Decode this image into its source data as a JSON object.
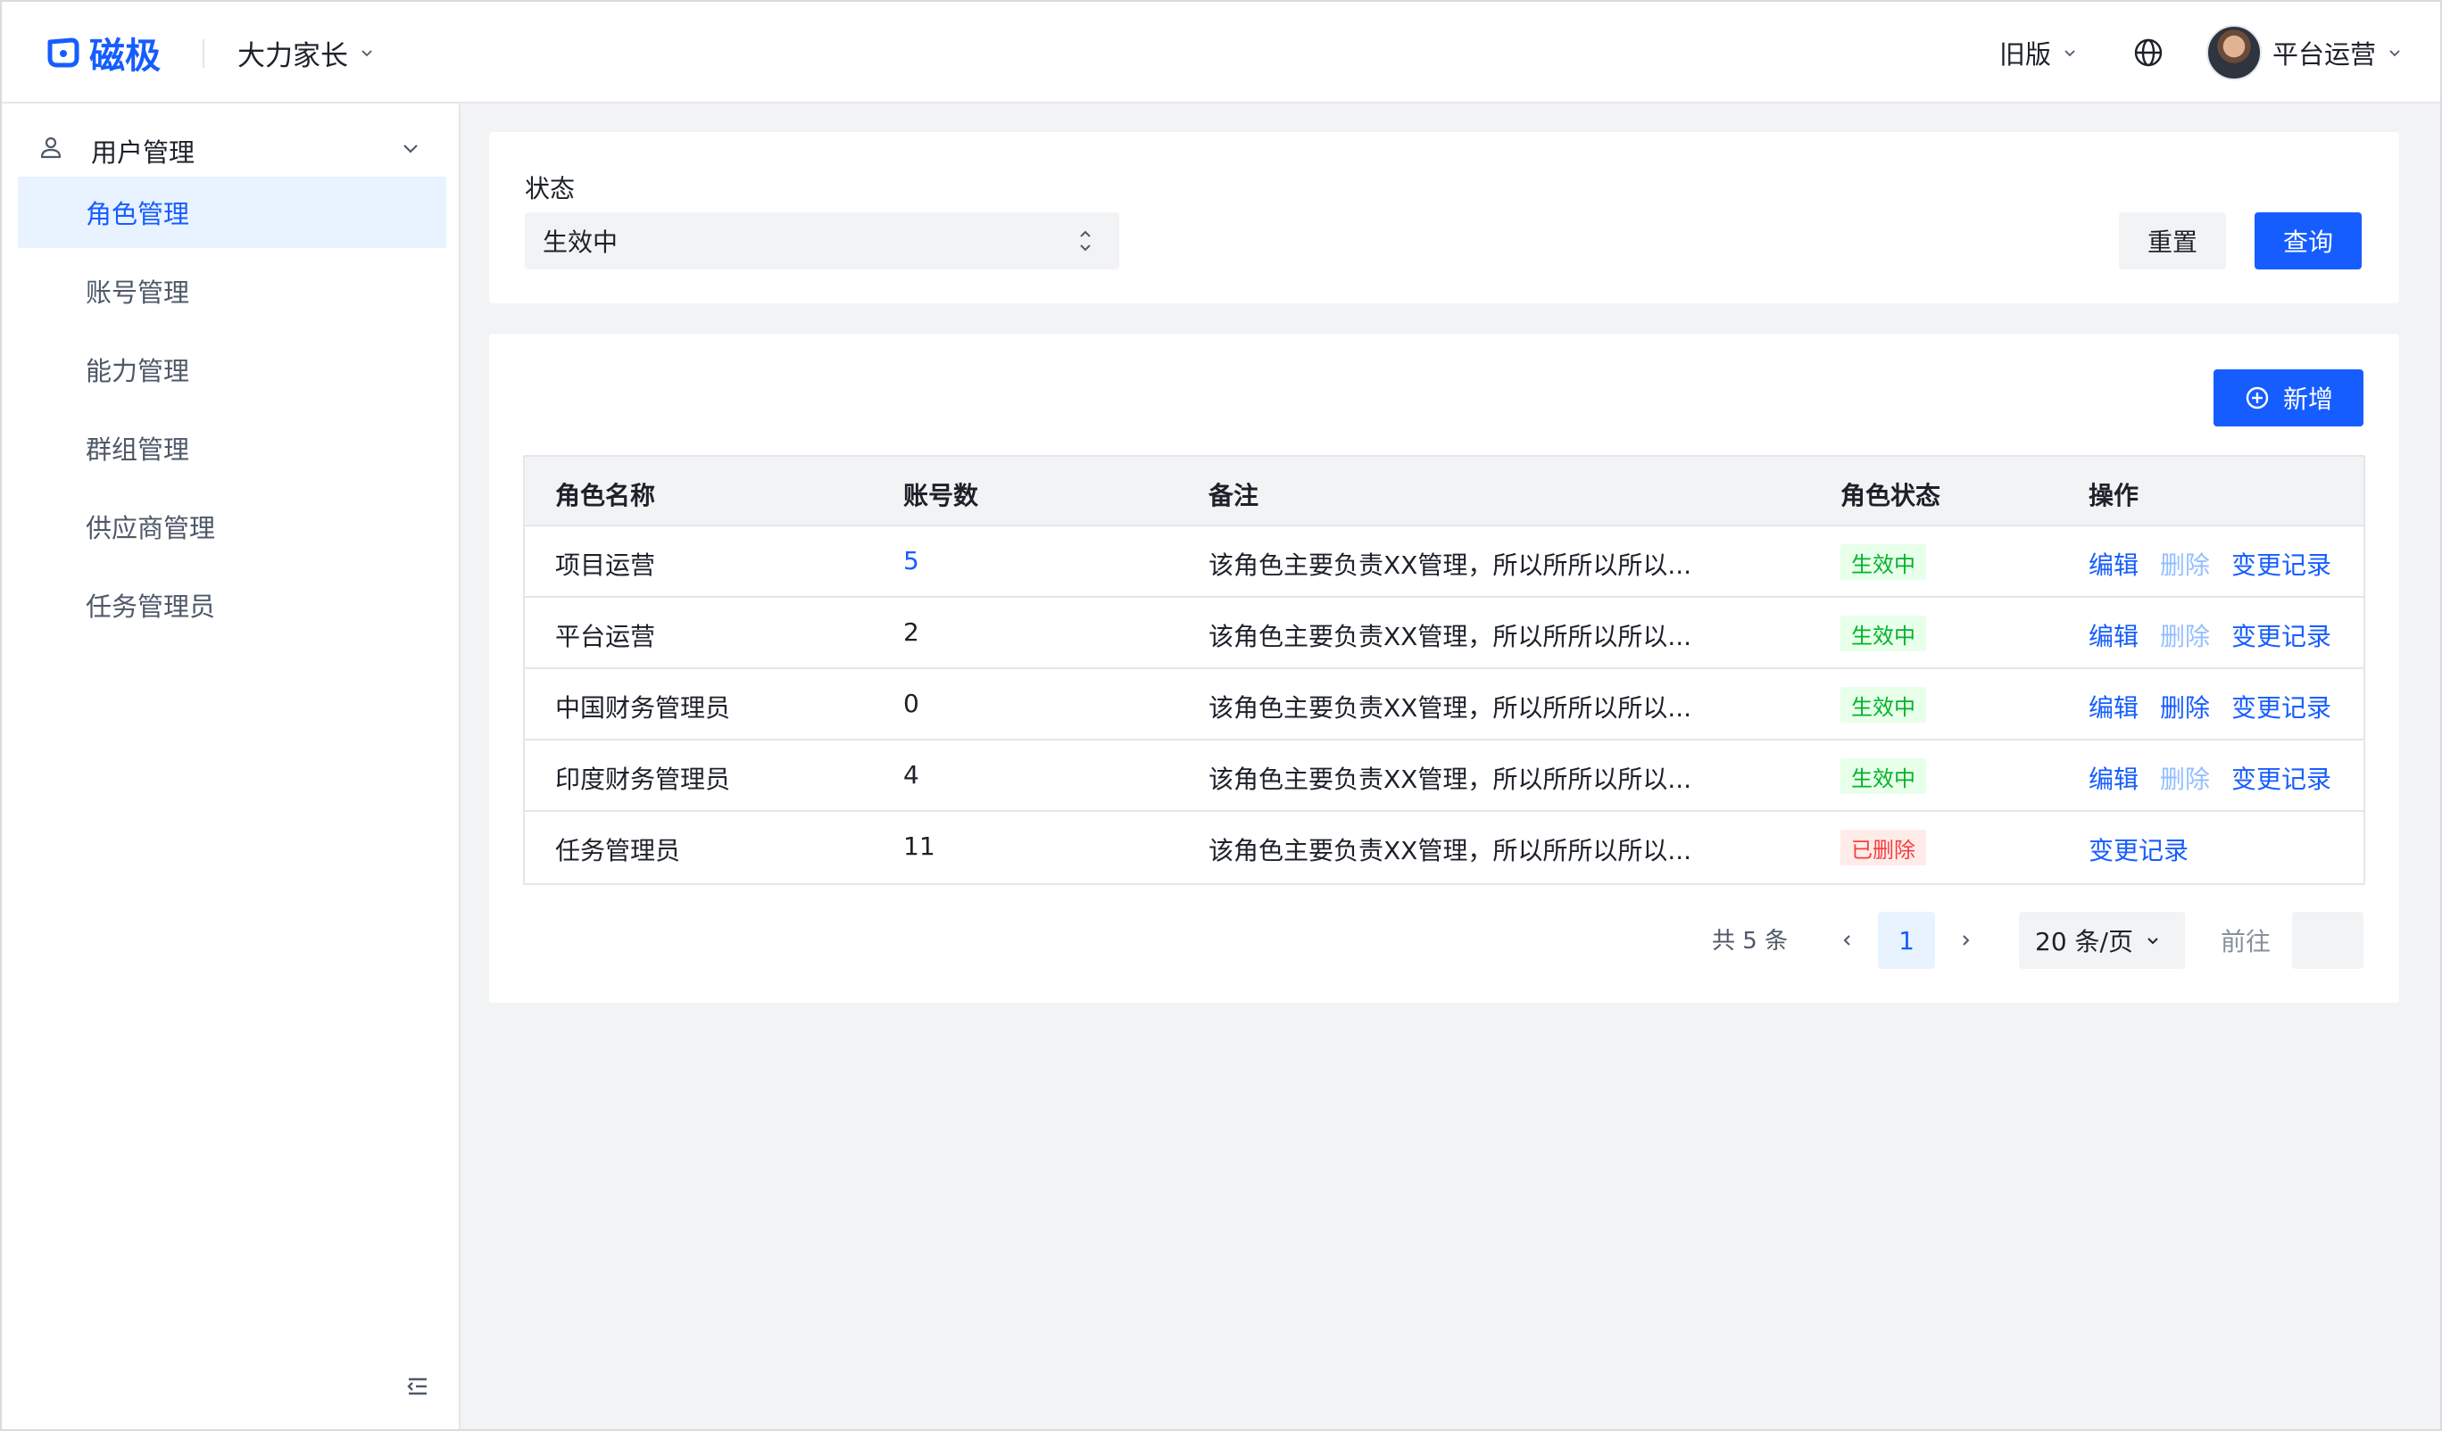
{
  "header": {
    "logo_text": "磁极",
    "tenant": "大力家长",
    "old_version": "旧版",
    "user_name": "平台运营"
  },
  "sidebar": {
    "group_label": "用户管理",
    "items": [
      {
        "label": "角色管理",
        "active": true
      },
      {
        "label": "账号管理",
        "active": false
      },
      {
        "label": "能力管理",
        "active": false
      },
      {
        "label": "群组管理",
        "active": false
      },
      {
        "label": "供应商管理",
        "active": false
      },
      {
        "label": "任务管理员",
        "active": false
      }
    ]
  },
  "filter": {
    "status_label": "状态",
    "status_value": "生效中",
    "reset_label": "重置",
    "query_label": "查询"
  },
  "table": {
    "add_label": "新增",
    "columns": [
      "角色名称",
      "账号数",
      "备注",
      "角色状态",
      "操作"
    ],
    "rows": [
      {
        "name": "项目运营",
        "count": "5",
        "note": "该角色主要负责XX管理，所以所所以所以...",
        "status": "生效中",
        "status_type": "active",
        "edit": "编辑",
        "delete": "删除",
        "delete_enabled": false,
        "log": "变更记录"
      },
      {
        "name": "平台运营",
        "count": "2",
        "note": "该角色主要负责XX管理，所以所所以所以...",
        "status": "生效中",
        "status_type": "active",
        "edit": "编辑",
        "delete": "删除",
        "delete_enabled": false,
        "log": "变更记录"
      },
      {
        "name": "中国财务管理员",
        "count": "0",
        "note": "该角色主要负责XX管理，所以所所以所以...",
        "status": "生效中",
        "status_type": "active",
        "edit": "编辑",
        "delete": "删除",
        "delete_enabled": true,
        "log": "变更记录"
      },
      {
        "name": "印度财务管理员",
        "count": "4",
        "note": "该角色主要负责XX管理，所以所所以所以...",
        "status": "生效中",
        "status_type": "active",
        "edit": "编辑",
        "delete": "删除",
        "delete_enabled": false,
        "log": "变更记录"
      },
      {
        "name": "任务管理员",
        "count": "11",
        "note": "该角色主要负责XX管理，所以所所以所以...",
        "status": "已删除",
        "status_type": "deleted",
        "log": "变更记录"
      }
    ]
  },
  "pagination": {
    "total": "共 5 条",
    "current_page": "1",
    "page_size": "20 条/页",
    "goto_label": "前往"
  },
  "colors": {
    "primary": "#165dff",
    "success": "#00b42a",
    "danger": "#f53f3f",
    "disabled_link": "#94bfff"
  }
}
